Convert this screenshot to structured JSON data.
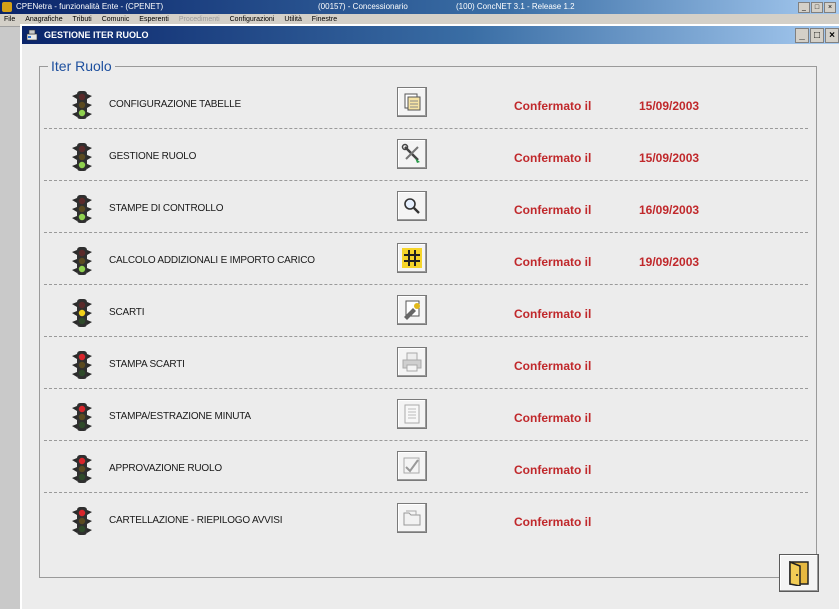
{
  "app": {
    "title_left": "CPENetra - funzionalità Ente - (CPENET)",
    "title_mid": "(00157) - Concessionario",
    "title_right": "(100) ConcNET 3.1 - Release 1.2",
    "window_buttons": [
      "_",
      "□",
      "×"
    ]
  },
  "menu": {
    "items": [
      {
        "label": "File",
        "disabled": false
      },
      {
        "label": "Anagrafiche",
        "disabled": false
      },
      {
        "label": "Tributi",
        "disabled": false
      },
      {
        "label": "Comunic",
        "disabled": false
      },
      {
        "label": "Esperenti",
        "disabled": false
      },
      {
        "label": "Procedimenti",
        "disabled": true
      },
      {
        "label": "Configurazioni",
        "disabled": false
      },
      {
        "label": "Utilità",
        "disabled": false
      },
      {
        "label": "Finestre",
        "disabled": false
      }
    ]
  },
  "child_window": {
    "title": "GESTIONE ITER RUOLO",
    "buttons": [
      "_",
      "□",
      "×"
    ]
  },
  "group": {
    "label": "Iter Ruolo"
  },
  "colors": {
    "status_red": "#c0282b",
    "label_blue": "#1d4f9e",
    "light_green": "#8fd14f",
    "light_yellow": "#f2d21a",
    "light_red": "#d8252b"
  },
  "steps": [
    {
      "label": "CONFIGURAZIONE TABELLE",
      "light": "green",
      "icon": "table-config-icon",
      "status": "Confermato il",
      "date": "15/09/2003",
      "enabled": true
    },
    {
      "label": "GESTIONE RUOLO",
      "light": "green",
      "icon": "tools-icon",
      "status": "Confermato il",
      "date": "15/09/2003",
      "enabled": true
    },
    {
      "label": "STAMPE DI CONTROLLO",
      "light": "green",
      "icon": "magnifier-icon",
      "status": "Confermato il",
      "date": "16/09/2003",
      "enabled": true
    },
    {
      "label": "CALCOLO ADDIZIONALI E IMPORTO CARICO",
      "light": "green",
      "icon": "calculation-icon",
      "status": "Confermato il",
      "date": "19/09/2003",
      "enabled": true
    },
    {
      "label": "SCARTI",
      "light": "yellow",
      "icon": "discard-icon",
      "status": "Confermato il",
      "date": "",
      "enabled": true
    },
    {
      "label": "STAMPA SCARTI",
      "light": "red",
      "icon": "printer-icon",
      "status": "Confermato il",
      "date": "",
      "enabled": false
    },
    {
      "label": "STAMPA/ESTRAZIONE MINUTA",
      "light": "red",
      "icon": "document-icon",
      "status": "Confermato il",
      "date": "",
      "enabled": false
    },
    {
      "label": "APPROVAZIONE RUOLO",
      "light": "red",
      "icon": "approve-icon",
      "status": "Confermato il",
      "date": "",
      "enabled": false
    },
    {
      "label": "CARTELLAZIONE - RIEPILOGO AVVISI",
      "light": "red",
      "icon": "folder-icon",
      "status": "Confermato il",
      "date": "",
      "enabled": false
    }
  ],
  "exit": {
    "icon": "exit-door-icon"
  }
}
